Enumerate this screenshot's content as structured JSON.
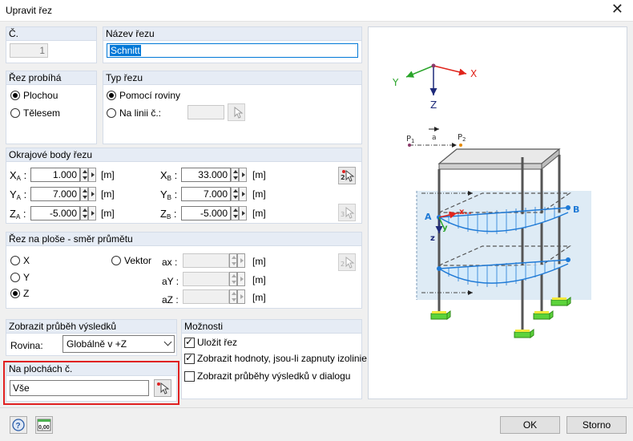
{
  "window": {
    "title": "Upravit řez",
    "close_icon": "close-icon"
  },
  "number": {
    "label": "Č.",
    "value": "1"
  },
  "name": {
    "label": "Název řezu",
    "value": "Schnitt"
  },
  "section_runs": {
    "label": "Řez probíhá",
    "opt1": "Plochou",
    "opt2": "Tělesem",
    "selected": "Plochou"
  },
  "section_type": {
    "label": "Typ řezu",
    "opt1": "Pomocí roviny",
    "opt2": "Na linii č.:",
    "selected": "Pomocí roviny"
  },
  "boundary": {
    "label": "Okrajové body řezu",
    "xa_label": "X",
    "xa_sub": "A",
    "xa": "1.000",
    "ya_label": "Y",
    "ya_sub": "A",
    "ya": "7.000",
    "za_label": "Z",
    "za_sub": "A",
    "za": "-5.000",
    "xb_label": "X",
    "xb_sub": "B",
    "xb": "33.000",
    "yb_label": "Y",
    "yb_sub": "B",
    "yb": "7.000",
    "zb_label": "Z",
    "zb_sub": "B",
    "zb": "-5.000",
    "unit": "[m]"
  },
  "projection": {
    "label": "Řez na ploše - směr průmětu",
    "opt_x": "X",
    "opt_y": "Y",
    "opt_z": "Z",
    "opt_vector": "Vektor",
    "selected": "Z",
    "ax_label": "ax :",
    "ay_label": "aY :",
    "az_label": "aZ :",
    "unit": "[m]"
  },
  "display": {
    "label": "Zobrazit průběh výsledků",
    "plane_label": "Rovina:",
    "plane_value": "Globálně v +Z"
  },
  "options": {
    "label": "Možnosti",
    "save": "Uložit řez",
    "save_checked": true,
    "show_values": "Zobrazit hodnoty, jsou-li zapnuty izolinie",
    "show_values_checked": true,
    "show_diagrams": "Zobrazit průběhy výsledků v dialogu",
    "show_diagrams_checked": false
  },
  "surfaces": {
    "label": "Na plochách č.",
    "value": "Vše"
  },
  "footer": {
    "ok": "OK",
    "cancel": "Storno",
    "help_icon": "help-icon",
    "units_icon": "units-icon",
    "units_text": "0,00"
  },
  "figure": {
    "axis_x": "X",
    "axis_y": "Y",
    "axis_z": "Z",
    "p1": "P",
    "p1_sub": "1",
    "p2": "P",
    "p2_sub": "2",
    "a": "a",
    "pt_a": "A",
    "pt_b": "B",
    "loc_x": "x",
    "loc_y": "y",
    "loc_z": "z",
    "colors": {
      "x_axis": "#e0241b",
      "y_axis": "#2aa52a",
      "z_axis": "#1e2a7a",
      "diagram": "#1f7ad6",
      "support": "#38b000"
    }
  }
}
